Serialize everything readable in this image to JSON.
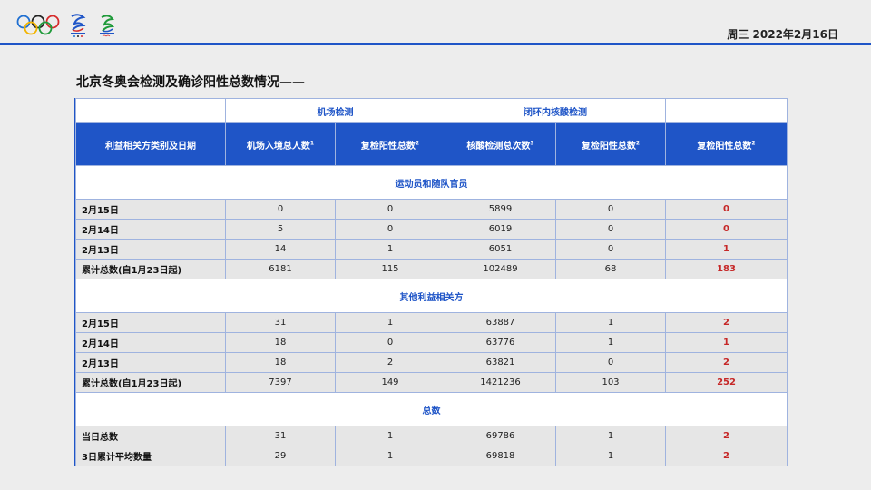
{
  "header": {
    "date": "周三 2022年2月16日"
  },
  "title": "北京冬奥会检测及确诊阳性总数情况——",
  "table": {
    "group_headers": [
      "",
      "机场检测",
      "闭环内核酸检测",
      ""
    ],
    "columns": [
      {
        "text": "利益相关方类别及日期",
        "sup": ""
      },
      {
        "text": "机场入境总人数",
        "sup": "1"
      },
      {
        "text": "复检阳性总数",
        "sup": "2"
      },
      {
        "text": "核酸检测总次数",
        "sup": "3"
      },
      {
        "text": "复检阳性总数",
        "sup": "2"
      },
      {
        "text": "复检阳性总数",
        "sup": "2"
      }
    ],
    "sections": [
      {
        "name": "运动员和随队官员",
        "rows": [
          [
            "2月15日",
            "0",
            "0",
            "5899",
            "0",
            "0"
          ],
          [
            "2月14日",
            "5",
            "0",
            "6019",
            "0",
            "0"
          ],
          [
            "2月13日",
            "14",
            "1",
            "6051",
            "0",
            "1"
          ],
          [
            "累计总数(自1月23日起)",
            "6181",
            "115",
            "102489",
            "68",
            "183"
          ]
        ]
      },
      {
        "name": "其他利益相关方",
        "rows": [
          [
            "2月15日",
            "31",
            "1",
            "63887",
            "1",
            "2"
          ],
          [
            "2月14日",
            "18",
            "0",
            "63776",
            "1",
            "1"
          ],
          [
            "2月13日",
            "18",
            "2",
            "63821",
            "0",
            "2"
          ],
          [
            "累计总数(自1月23日起)",
            "7397",
            "149",
            "1421236",
            "103",
            "252"
          ]
        ]
      },
      {
        "name": "总数",
        "rows": [
          [
            "当日总数",
            "31",
            "1",
            "69786",
            "1",
            "2"
          ],
          [
            "3日累计平均数量",
            "29",
            "1",
            "69818",
            "1",
            "2"
          ]
        ]
      }
    ]
  }
}
